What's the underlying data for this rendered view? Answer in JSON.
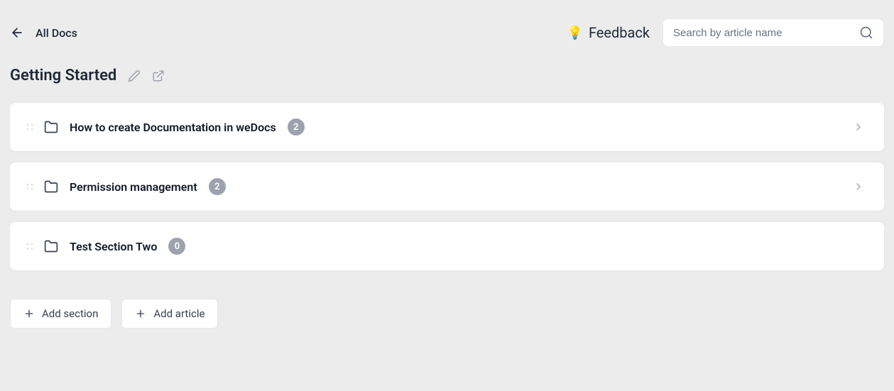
{
  "topbar": {
    "back_label": "All Docs"
  },
  "feedback": {
    "icon": "💡",
    "label": "Feedback"
  },
  "search": {
    "placeholder": "Search by article name",
    "value": ""
  },
  "page": {
    "title": "Getting Started"
  },
  "sections": [
    {
      "title": "How to create Documentation in weDocs",
      "count": "2",
      "has_chevron": true
    },
    {
      "title": "Permission management",
      "count": "2",
      "has_chevron": true
    },
    {
      "title": "Test Section Two",
      "count": "0",
      "has_chevron": false
    }
  ],
  "actions": {
    "add_section": "Add section",
    "add_article": "Add article"
  }
}
